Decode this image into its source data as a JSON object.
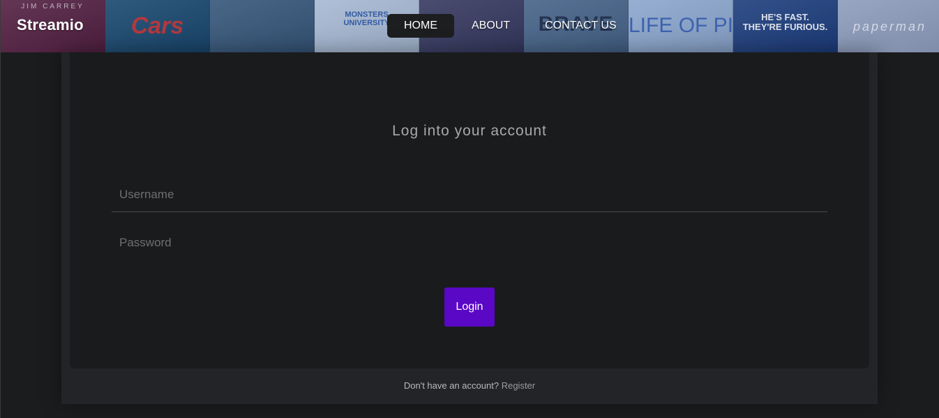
{
  "header": {
    "brand": "Streamio",
    "nav": [
      {
        "label": "HOME",
        "active": true
      },
      {
        "label": "ABOUT",
        "active": false
      },
      {
        "label": "CONTACT US",
        "active": false
      }
    ],
    "posters": [
      {
        "text": "JIM CARREY",
        "bg": "#6a2f4a",
        "fg": "#d9c7c9"
      },
      {
        "text": "Cars",
        "bg": "#2b5a7a",
        "fg": "#c9322f"
      },
      {
        "text": "",
        "bg": "#4a6a86",
        "fg": "#ffffff"
      },
      {
        "text": "MONSTERS UNIVERSITY",
        "bg": "#c6d6e8",
        "fg": "#2d5aa8"
      },
      {
        "text": "",
        "bg": "#4a4a6a",
        "fg": "#ffffff"
      },
      {
        "text": "BRAVE",
        "bg": "#5b7896",
        "fg": "#1e2e46"
      },
      {
        "text": "LIFE OF PI",
        "bg": "#a8c2e2",
        "fg": "#3b63b8"
      },
      {
        "text": "HE'S FAST. THEY'RE FURIOUS.",
        "bg": "#2f4f8a",
        "fg": "#ffffff"
      },
      {
        "text": "paperman",
        "bg": "#aab7cf",
        "fg": "#f1f4f9"
      }
    ]
  },
  "form": {
    "title": "Log into your account",
    "username_placeholder": "Username",
    "password_placeholder": "Password",
    "login_label": "Login"
  },
  "footer": {
    "prompt": "Don't have an account?",
    "register_label": "Register"
  },
  "colors": {
    "accent": "#5a08c5",
    "background": "#1b1c1e"
  }
}
